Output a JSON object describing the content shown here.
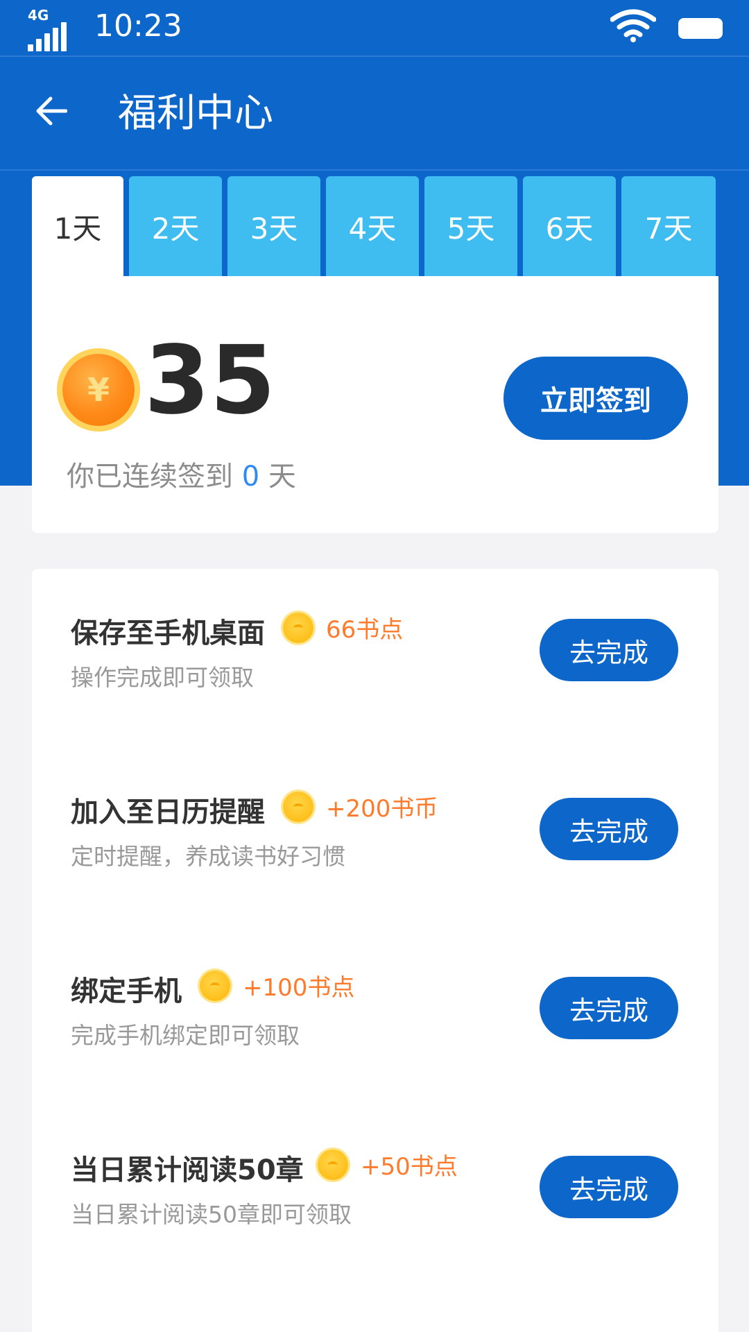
{
  "status_bar": {
    "network": "4G",
    "time": "10:23"
  },
  "header": {
    "title": "福利中心"
  },
  "days": [
    "1天",
    "2天",
    "3天",
    "4天",
    "5天",
    "6天",
    "7天"
  ],
  "sign": {
    "amount": "35",
    "coin_symbol": "¥",
    "button_label": "立即签到",
    "streak_prefix": "你已连续签到",
    "streak_days": "0",
    "streak_suffix": "天"
  },
  "tasks": [
    {
      "title": "保存至手机桌面",
      "reward": "66书点",
      "desc": "操作完成即可领取",
      "button": "去完成"
    },
    {
      "title": "加入至日历提醒",
      "reward": "+200书币",
      "desc": "定时提醒，养成读书好习惯",
      "button": "去完成"
    },
    {
      "title": "绑定手机",
      "reward": "+100书点",
      "desc": "完成手机绑定即可领取",
      "button": "去完成"
    },
    {
      "title": "当日累计阅读50章",
      "reward": "+50书点",
      "desc": "当日累计阅读50章即可领取",
      "button": "去完成"
    }
  ],
  "colors": {
    "primary": "#0d66c9",
    "tab": "#40bdf0",
    "reward": "#ff7a2a",
    "streak_number": "#2f8bf3"
  }
}
